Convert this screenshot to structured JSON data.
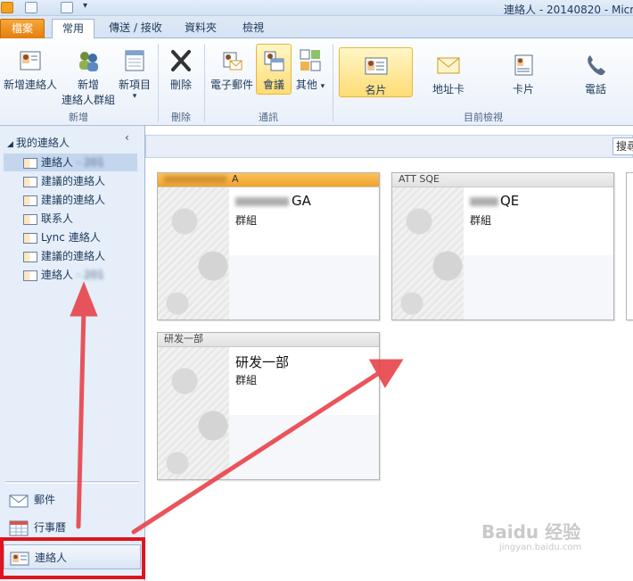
{
  "window": {
    "title": "連絡人 - 20140820 - Micr"
  },
  "tabs": [
    {
      "label": "檔案",
      "kind": "file"
    },
    {
      "label": "常用",
      "kind": "active"
    },
    {
      "label": "傳送 / 接收",
      "kind": ""
    },
    {
      "label": "資料夾",
      "kind": ""
    },
    {
      "label": "檢視",
      "kind": ""
    }
  ],
  "ribbon": {
    "new_group": {
      "label": "新增",
      "new_contact": "新增連絡人",
      "new_group_line1": "新增",
      "new_group_line2": "連絡人群組",
      "new_items": "新項目"
    },
    "delete_group": {
      "label": "刪除",
      "delete": "刪除"
    },
    "comm_group": {
      "label": "通訊",
      "email": "電子郵件",
      "meeting": "會議",
      "more": "其他"
    },
    "view_group": {
      "label": "目前檢視",
      "business_card": "名片",
      "address_card": "地址卡",
      "card": "卡片",
      "phone": "電話"
    }
  },
  "nav": {
    "header": "我的連絡人",
    "collapse": "‹",
    "items": [
      {
        "label": "連絡人",
        "suffix": " - 201",
        "selected": true
      },
      {
        "label": "建議的連絡人",
        "suffix": "",
        "selected": false
      },
      {
        "label": "建議的連絡人",
        "suffix": "",
        "selected": false
      },
      {
        "label": "联系人",
        "suffix": "",
        "selected": false
      },
      {
        "label": "Lync 連絡人",
        "suffix": "",
        "selected": false
      },
      {
        "label": "建議的連絡人",
        "suffix": "",
        "selected": false
      },
      {
        "label": "連絡人",
        "suffix": " - 201",
        "selected": false
      }
    ],
    "bottom": [
      {
        "label": "郵件"
      },
      {
        "label": "行事曆"
      },
      {
        "label": "連絡人"
      }
    ]
  },
  "main": {
    "search_placeholder": "搜尋",
    "cards": [
      {
        "header": "A",
        "name": "GA",
        "subtitle": "群組",
        "header_color": "orange"
      },
      {
        "header": "ATT SQE",
        "name": "QE",
        "subtitle": "群組",
        "header_color": "gray"
      },
      {
        "header": "研发一部",
        "name": "研发一部",
        "subtitle": "群組",
        "header_color": "gray"
      }
    ]
  },
  "watermark": {
    "brand": "Baidu 经验",
    "url": "jingyan.baidu.com"
  },
  "colors": {
    "accent": "#f0a22a",
    "annotation": "#e0141e"
  }
}
